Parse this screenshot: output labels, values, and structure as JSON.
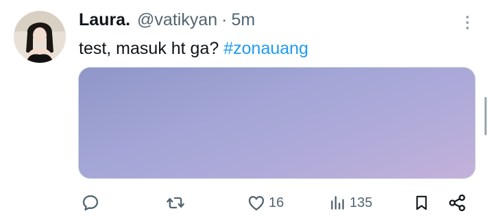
{
  "tweet": {
    "display_name": "Laura.",
    "handle": "@vatikyan",
    "separator": "·",
    "time": "5m",
    "text": "test, masuk ht ga?",
    "hashtag": "#zonauang",
    "avatar_icon": "user-avatar-photo",
    "more_icon": "more-vertical-icon"
  },
  "actions": {
    "reply": {
      "icon": "reply-icon",
      "count": ""
    },
    "retweet": {
      "icon": "retweet-icon",
      "count": ""
    },
    "like": {
      "icon": "heart-icon",
      "count": "16"
    },
    "views": {
      "icon": "analytics-icon",
      "count": "135"
    },
    "bookmark": {
      "icon": "bookmark-icon"
    },
    "share": {
      "icon": "share-icon"
    }
  },
  "colors": {
    "text": "#0f1419",
    "secondary": "#536471",
    "hashtag": "#1d9bf0",
    "media_start": "#8f96c8",
    "media_end": "#c3b1da"
  }
}
